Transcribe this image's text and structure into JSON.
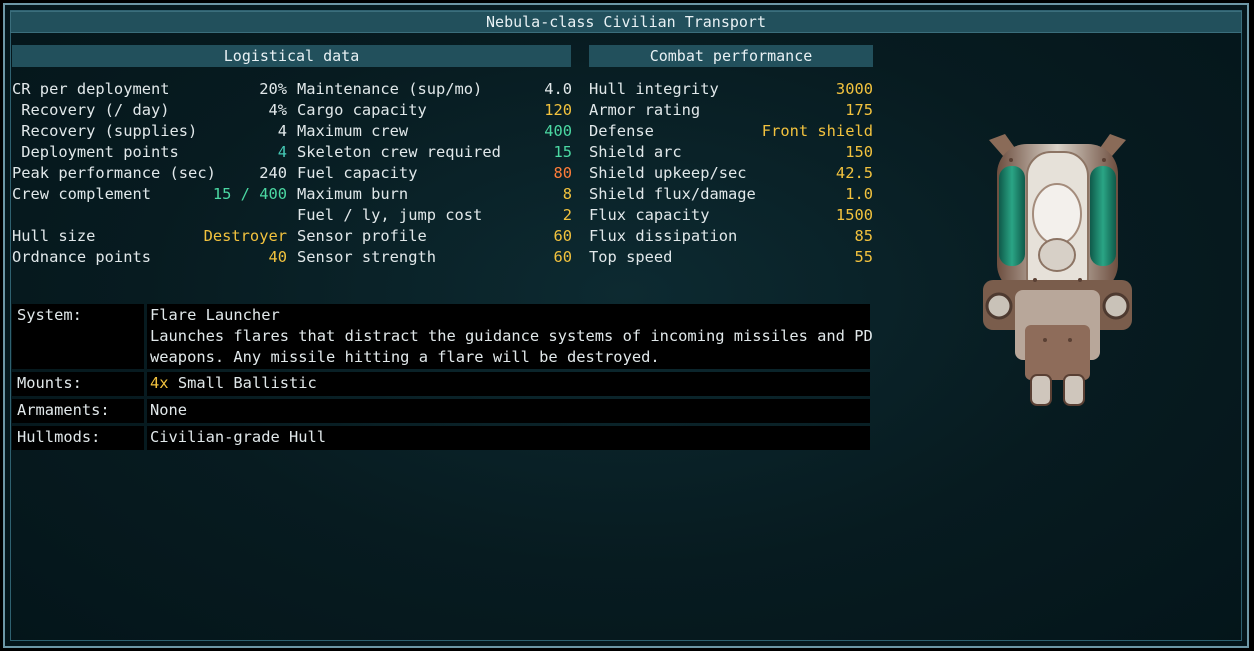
{
  "title": "Nebula-class Civilian Transport",
  "sections": {
    "logistical": "Logistical data",
    "combat": "Combat performance"
  },
  "logistical_left": [
    {
      "label": "CR per deployment",
      "value": "20%",
      "color": "white"
    },
    {
      "label": " Recovery (/ day)",
      "value": "4%",
      "color": "white"
    },
    {
      "label": " Recovery (supplies)",
      "value": "4",
      "color": "white"
    },
    {
      "label": " Deployment points",
      "value": "4",
      "color": "cyan"
    },
    {
      "label": "Peak performance (sec)",
      "value": "240",
      "color": "white"
    },
    {
      "label": "Crew complement",
      "value": "15 / 400",
      "color": "green"
    },
    {
      "label": "Hull size",
      "value": "Destroyer",
      "color": "yellow"
    },
    {
      "label": "Ordnance points",
      "value": "40",
      "color": "yellow"
    }
  ],
  "logistical_right": [
    {
      "label": "Maintenance (sup/mo)",
      "value": "4.0",
      "color": "white"
    },
    {
      "label": "Cargo capacity",
      "value": "120",
      "color": "yellow"
    },
    {
      "label": "Maximum crew",
      "value": "400",
      "color": "green"
    },
    {
      "label": "Skeleton crew required",
      "value": "15",
      "color": "green"
    },
    {
      "label": "Fuel capacity",
      "value": "80",
      "color": "orange"
    },
    {
      "label": "Maximum burn",
      "value": "8",
      "color": "yellow"
    },
    {
      "label": "Fuel / ly, jump cost",
      "value": "2",
      "color": "yellow"
    },
    {
      "label": "Sensor profile",
      "value": "60",
      "color": "yellow"
    },
    {
      "label": "Sensor strength",
      "value": "60",
      "color": "yellow"
    }
  ],
  "combat": [
    {
      "label": "Hull integrity",
      "value": "3000",
      "color": "yellow"
    },
    {
      "label": "Armor rating",
      "value": "175",
      "color": "yellow"
    },
    {
      "label": "Defense",
      "value": "Front shield",
      "color": "yellow"
    },
    {
      "label": "Shield arc",
      "value": "150",
      "color": "yellow"
    },
    {
      "label": "Shield upkeep/sec",
      "value": "42.5",
      "color": "yellow"
    },
    {
      "label": "Shield flux/damage",
      "value": "1.0",
      "color": "yellow"
    },
    {
      "label": "Flux capacity",
      "value": "1500",
      "color": "yellow"
    },
    {
      "label": "Flux dissipation",
      "value": "85",
      "color": "yellow"
    },
    {
      "label": "Top speed",
      "value": "55",
      "color": "yellow"
    }
  ],
  "details": {
    "system_label": "System:",
    "system_name": "Flare Launcher",
    "system_desc_1": "Launches flares that distract the guidance systems of incoming missiles and PD",
    "system_desc_2": "weapons. Any missile hitting a flare will be destroyed.",
    "mounts_label": "Mounts:",
    "mounts_count": "4x",
    "mounts_type": " Small Ballistic",
    "armaments_label": "Armaments:",
    "armaments_value": "None",
    "hullmods_label": "Hullmods:",
    "hullmods_value": "Civilian-grade Hull"
  },
  "colors": {
    "frame": "#6d97a6",
    "header_bg": "#22505c",
    "background": "#071b20",
    "yellow": "#f2c23e",
    "cyan": "#45c8b4",
    "green": "#4bd8a2",
    "orange": "#ff7d3a"
  },
  "icons": {
    "ship": "nebula-class-transport-sprite"
  }
}
